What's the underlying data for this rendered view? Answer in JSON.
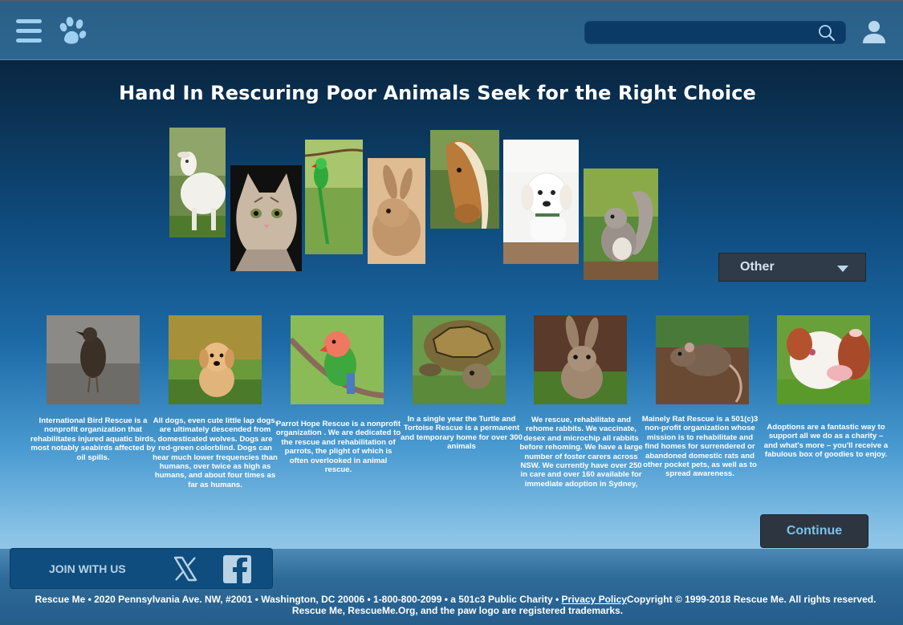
{
  "header": {
    "menu_icon": "hamburger-menu-icon",
    "logo_icon": "paw-logo-icon",
    "search": {
      "value": "",
      "placeholder": "",
      "icon": "search-icon"
    },
    "user_icon": "user-icon"
  },
  "title": "Hand In Rescuring Poor Animals Seek for the Right Choice",
  "gallery": [
    "goat",
    "cat",
    "parrot",
    "rabbit",
    "horse",
    "puppy",
    "squirrel"
  ],
  "filter": {
    "selected": "Other",
    "icon": "chevron-down-icon"
  },
  "cards": [
    {
      "animal": "bird",
      "text": "International Bird Rescue is a nonprofit organization that rehabilitates injured aquatic birds, most notably seabirds affected by oil spills."
    },
    {
      "animal": "dog",
      "text": "All dogs, even cute little lap dogs, are ultimately descended from domesticated wolves. Dogs are red-green colorblind. Dogs can hear much lower frequencies than humans, over twice as high as humans, and about four times as far as humans."
    },
    {
      "animal": "parrot",
      "text": "Parrot Hope Rescue is a nonprofit organization . We are dedicated to the rescue and rehabilitation of parrots, the plight of which is often overlooked in animal rescue."
    },
    {
      "animal": "tortoise",
      "text": "In a single year the Turtle and Tortoise Rescue is a permanent and temporary home for over 300 animals"
    },
    {
      "animal": "rabbit",
      "text": "We rescue, rehabilitate and rehome rabbits. We vaccinate, desex and microchip all rabbits before rehoming. We have a large number of foster carers across NSW. We currently have over 250 in care and over 160 available for immediate adoption in Sydney,"
    },
    {
      "animal": "rat",
      "text": "Mainely Rat Rescue is a 501(c)3 non-profit organization whose mission is to rehabilitate and find homes for surrendered or abandoned domestic rats and other pocket pets, as well as to spread awareness."
    },
    {
      "animal": "calf",
      "text": "Adoptions are a fantastic way to support all we do as a charity – and what's more – you'll receive a fabulous box of goodies to enjoy."
    }
  ],
  "continue_label": "Continue",
  "join": {
    "label": "JOIN WITH US",
    "x_icon": "x-twitter-icon",
    "fb_icon": "facebook-icon"
  },
  "footer": {
    "line1_prefix": "Rescue Me • 2020 Pennsylvania Ave. NW, #2001 • Washington, DC 20006 • 1-800-800-2099 • a 501c3 Public Charity • ",
    "privacy": "Privacy Policy",
    "line1_suffix": "Copyright © 1999-2018 Rescue Me. All rights reserved.",
    "line2": "Rescue Me, RescueMe.Org, and the paw logo are registered trademarks."
  },
  "colors": {
    "accent": "#7dc1ea",
    "topbar": "#2a5f87",
    "dropdown": "#2f3b48"
  }
}
